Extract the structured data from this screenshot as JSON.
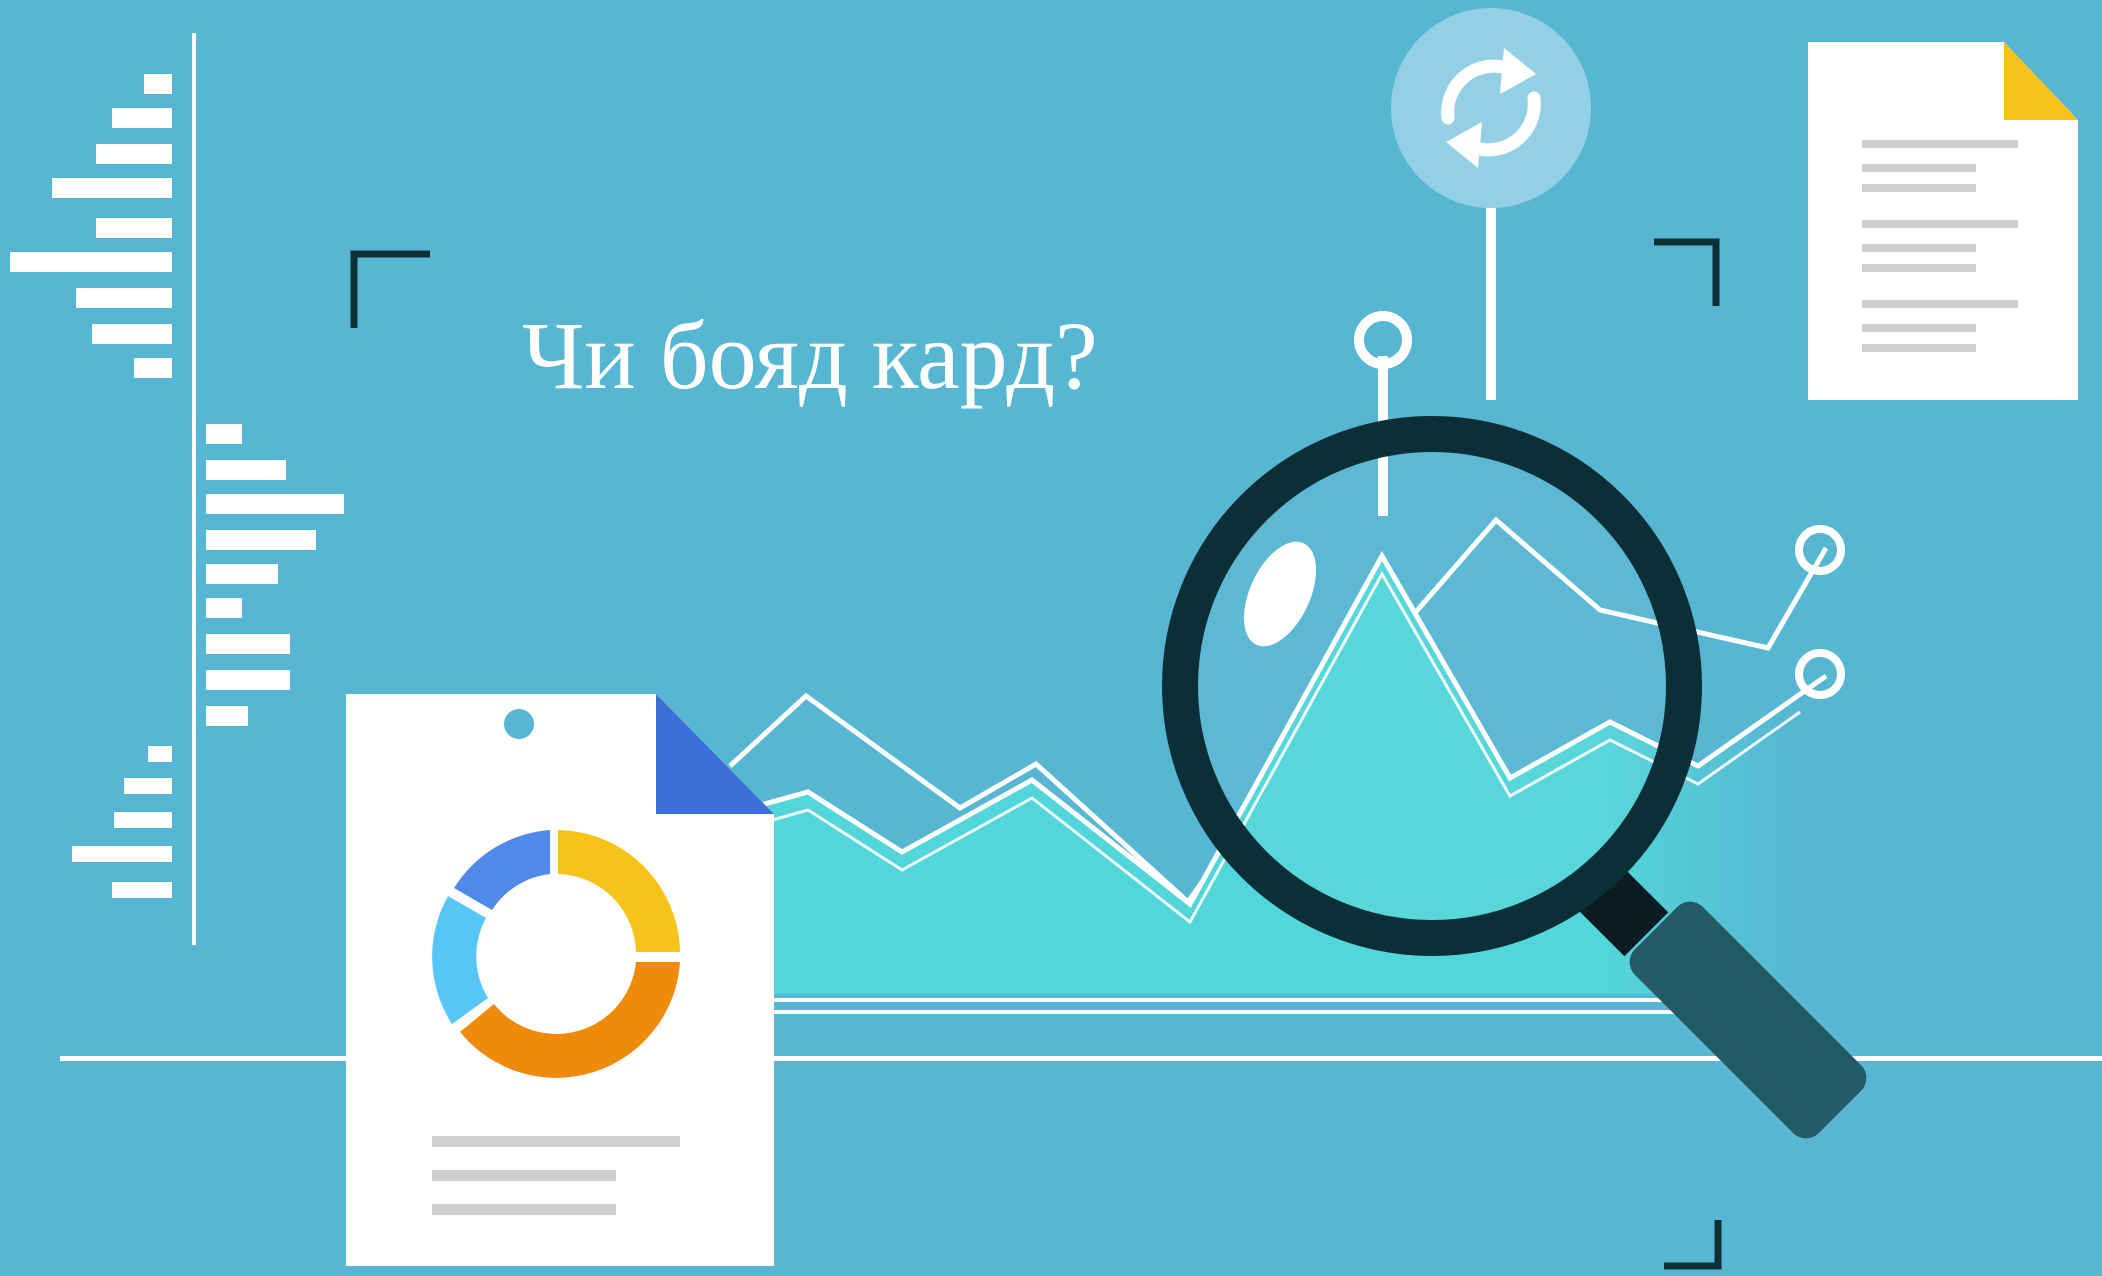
{
  "headline": "Чи бояд кард?",
  "colors": {
    "background": "#57b6d2",
    "area_fill": "#52d6d9",
    "lens_ring": "#0b2f36",
    "handle": "#245966",
    "doc_corner_yellow": "#f6c21a",
    "doc_corner_blue": "#3d6fd6",
    "donut_yellow": "#f7c31b",
    "donut_orange": "#ef8a0b",
    "donut_lightblue": "#56c6f7",
    "donut_blue": "#5089ea",
    "sync_circle": "#93d0e6"
  },
  "icons": [
    "sync-icon",
    "magnifying-glass-icon",
    "document-icon",
    "donut-chart-icon"
  ]
}
